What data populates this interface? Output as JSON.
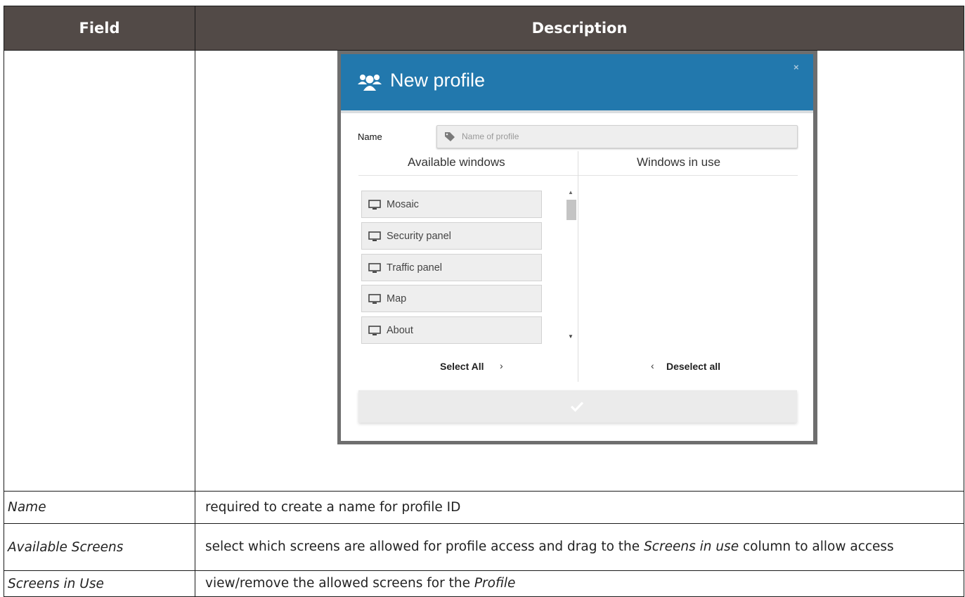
{
  "table": {
    "header_field": "Field",
    "header_description": "Description",
    "rows": [
      {
        "field": "Name",
        "description": "required to create a name for profile ID"
      },
      {
        "field": "Available Screens",
        "desc_before": "select which screens are allowed for profile access and drag to the ",
        "desc_italic": "Screens in use",
        "desc_after": " column to allow access"
      },
      {
        "field": "Screens in Use",
        "desc_before": "view/remove the allowed screens for the ",
        "desc_italic": "Profile"
      }
    ]
  },
  "dialog": {
    "title": "New profile",
    "close": "×",
    "name_label": "Name",
    "name_placeholder": "Name of profile",
    "available_header": "Available windows",
    "in_use_header": "Windows in use",
    "windows": [
      {
        "label": "Mosaic",
        "icon": "monitor-icon"
      },
      {
        "label": "Security panel",
        "icon": "monitor-icon"
      },
      {
        "label": "Traffic panel",
        "icon": "monitor-icon"
      },
      {
        "label": "Map",
        "icon": "monitor-icon"
      },
      {
        "label": "About",
        "icon": "monitor-icon"
      }
    ],
    "select_all": "Select All",
    "select_all_chevron": "›",
    "deselect_all": "Deselect all",
    "deselect_chevron": "‹",
    "colors": {
      "header": "#2278ad",
      "table_header": "#524a47"
    }
  }
}
